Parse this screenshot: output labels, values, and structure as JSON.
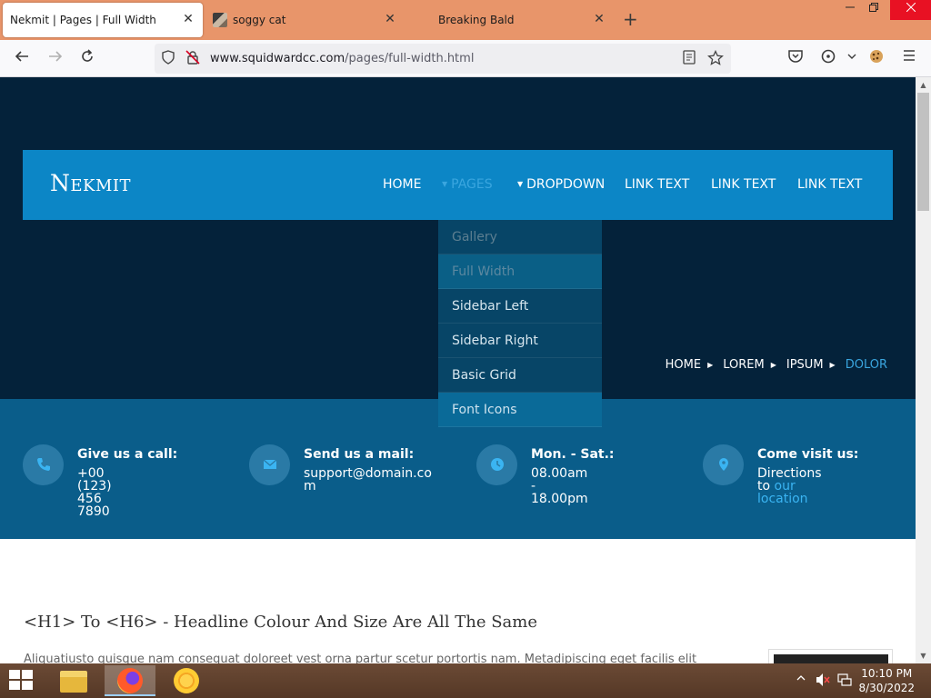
{
  "browser": {
    "tabs": [
      {
        "title": "Nekmit | Pages | Full Width",
        "active": true
      },
      {
        "title": "soggy cat",
        "active": false
      },
      {
        "title": "Breaking Bald",
        "active": false
      }
    ],
    "url_host": "www.squidwardcc.com",
    "url_path": "/pages/full-width.html",
    "close_glyph": "✕",
    "new_tab_glyph": "+"
  },
  "site": {
    "logo": "Nekmit",
    "nav": [
      "HOME",
      "PAGES",
      "DROPDOWN",
      "LINK TEXT",
      "LINK TEXT",
      "LINK TEXT"
    ],
    "dropdown": [
      "Gallery",
      "Full Width",
      "Sidebar Left",
      "Sidebar Right",
      "Basic Grid",
      "Font Icons"
    ],
    "breadcrumb": [
      "HOME",
      "LOREM",
      "IPSUM",
      "DOLOR"
    ],
    "info": [
      {
        "title": "Give us a call:",
        "line1": "+00 (123) 456 7890",
        "line2": "",
        "icon": "phone-icon"
      },
      {
        "title": "Send us a mail:",
        "line1": "support@domain.co",
        "line2": "m",
        "icon": "envelope-icon"
      },
      {
        "title": "Mon. - Sat.:",
        "line1": "08.00am - 18.00pm",
        "line2": "",
        "icon": "clock-icon"
      },
      {
        "title": "Come visit us:",
        "line1": "Directions to",
        "link1": "our",
        "link2": "location",
        "icon": "map-marker-icon"
      }
    ],
    "headline": "<H1> To <H6> - Headline Colour And Size Are All The Same",
    "paragraph": "Aliquatiusto quisque nam consequat doloreet vest orna partur scetur portortis nam. Metadipiscing eget facilis elit"
  },
  "taskbar": {
    "time": "10:10 PM",
    "date": "8/30/2022"
  },
  "colors": {
    "tab_strip": "#e8956a",
    "hero": "#04223a",
    "navbar": "#0c86c6",
    "accent": "#3aa6df",
    "infobar": "#0a5d8a"
  }
}
